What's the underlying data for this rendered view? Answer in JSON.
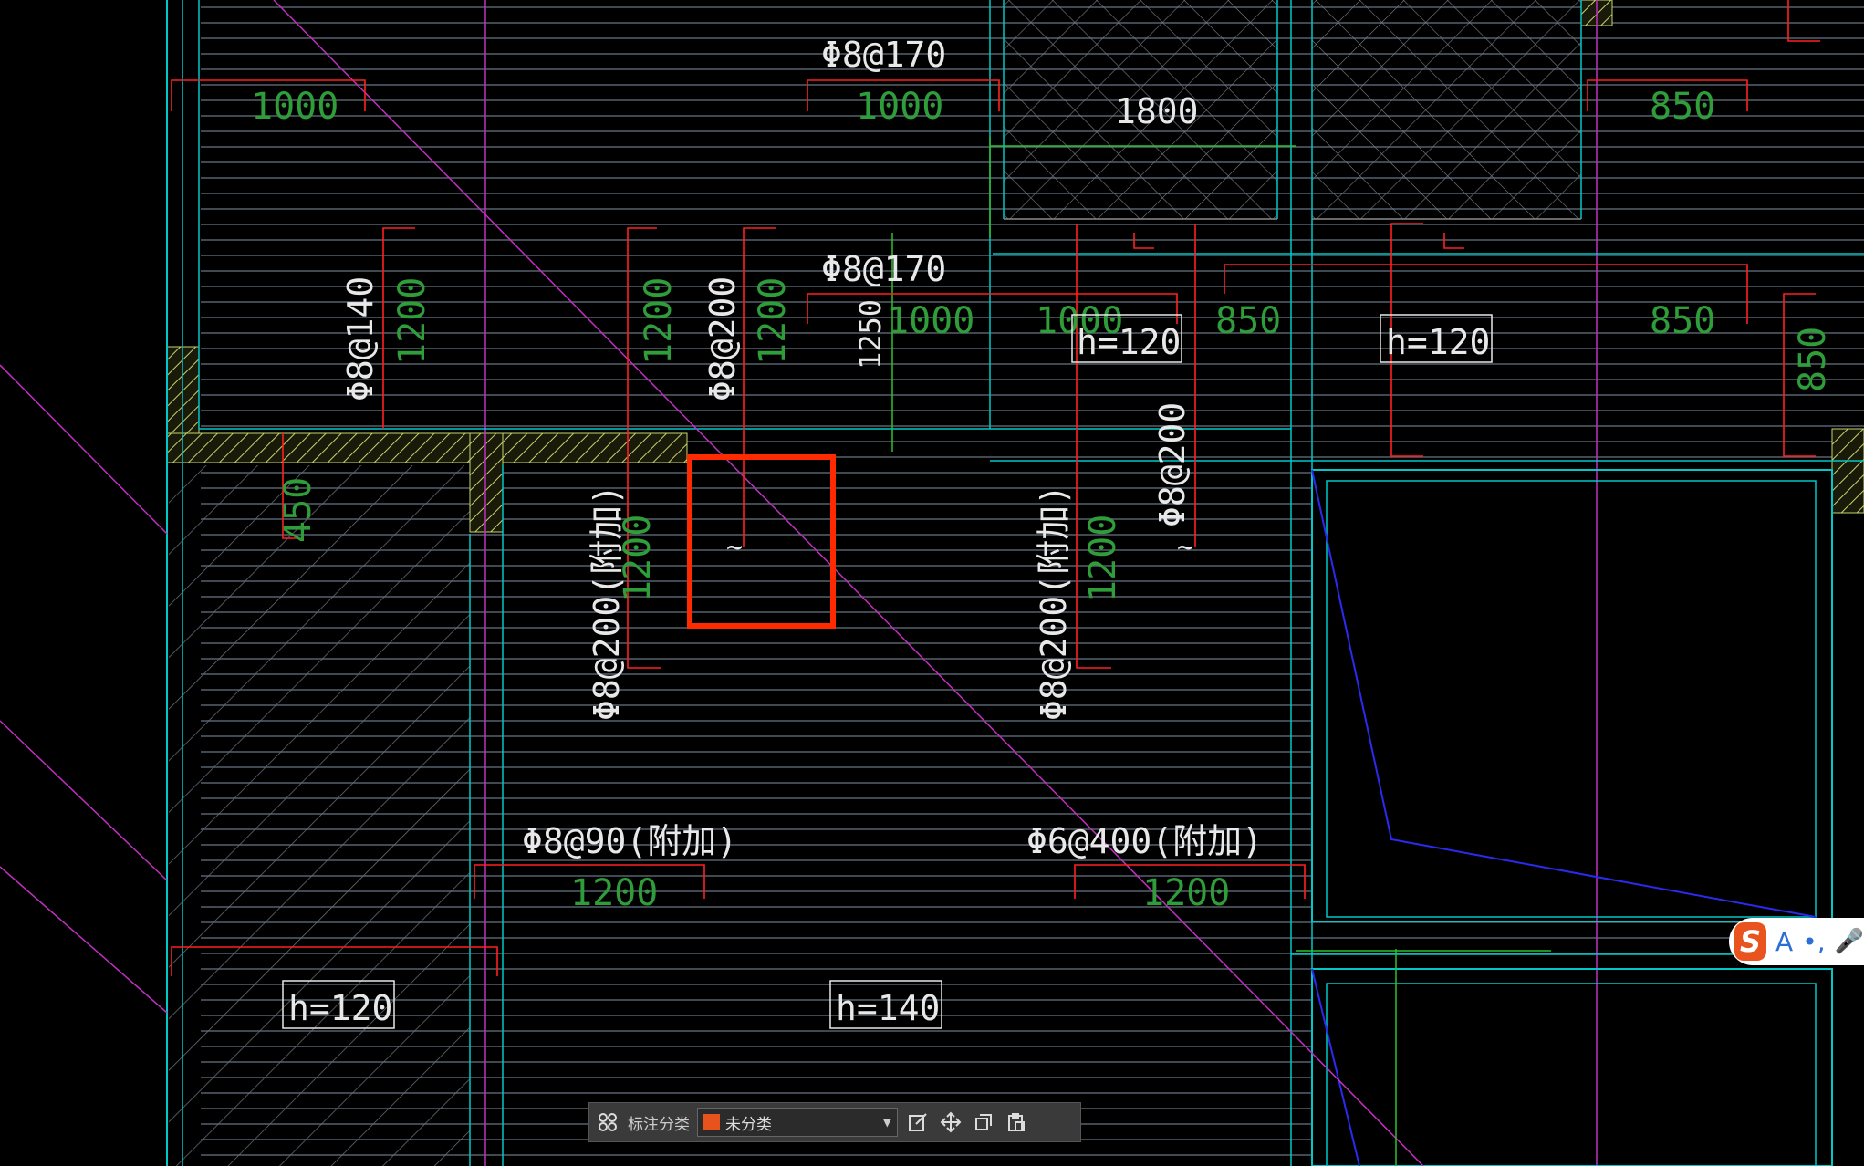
{
  "drawing": {
    "rebar_labels": [
      "Φ8@170",
      "Φ8@170",
      "Φ8@140",
      "Φ8@200",
      "Φ8@200",
      "Φ8@200(附加)",
      "Φ8@200(附加)",
      "Φ8@90(附加)",
      "Φ6@400(附加)"
    ],
    "dims": [
      "1000",
      "1000",
      "1800",
      "1200",
      "1200",
      "1200",
      "1250",
      "1000",
      "1000",
      "850",
      "850",
      "850",
      "850",
      "450",
      "1200",
      "1200",
      "1200",
      "1200"
    ],
    "thickness_tags": [
      "h=120",
      "h=120",
      "h=120",
      "h=140"
    ],
    "tilde": "~"
  },
  "toolbar": {
    "label": "标注分类",
    "category_value": "未分类",
    "swatch_color": "#e8531d",
    "icons": [
      "grid-icon",
      "edit-icon",
      "move-icon",
      "copy-icon",
      "paste-icon"
    ]
  },
  "colors": {
    "background": "#000000",
    "hatch": "#56606e",
    "wall_hatch": "#c8d36a",
    "rebar": "#ff2020",
    "dim_text": "#2e9d3a",
    "cyan": "#00c8c8",
    "magenta": "#c030c0",
    "highlight": "#ff2a00"
  },
  "ime": {
    "letter": "S",
    "mode": "A",
    "punct": "•,",
    "mic": "🎤"
  }
}
